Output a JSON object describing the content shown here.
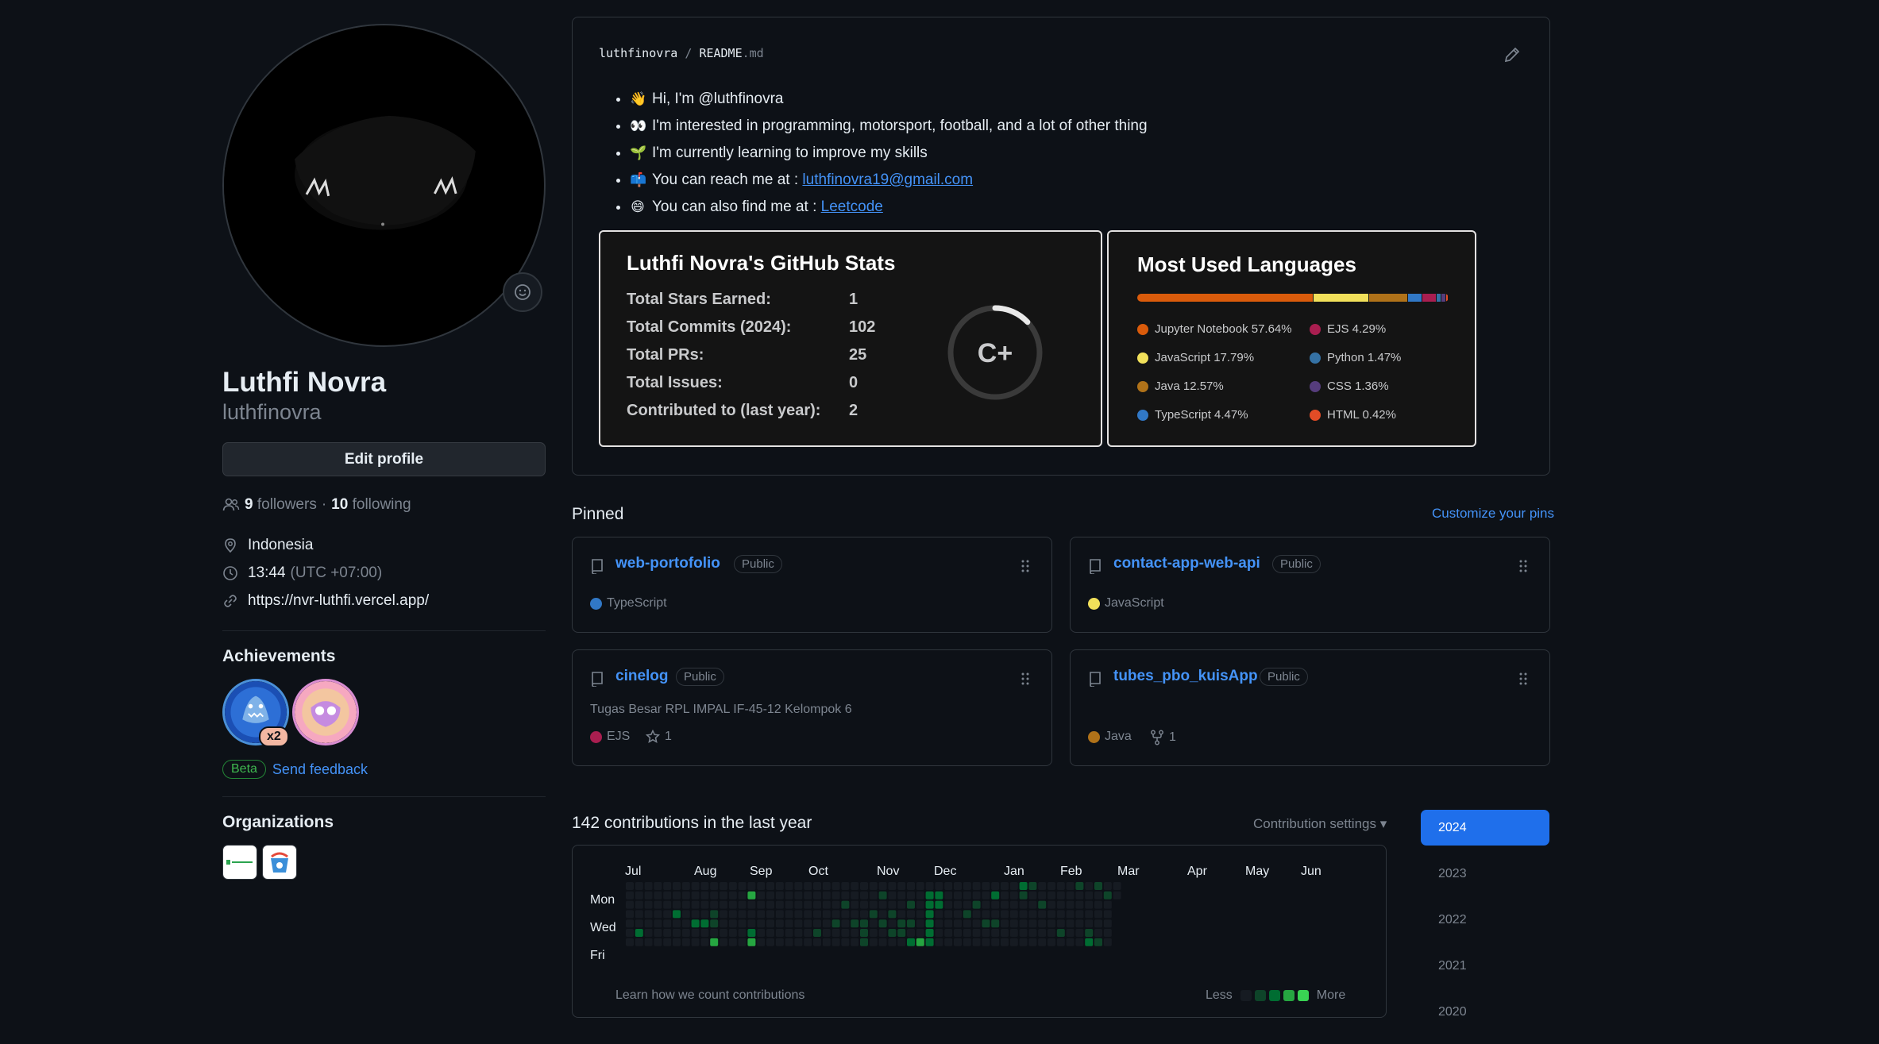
{
  "profile": {
    "full_name": "Luthfi Novra",
    "login": "luthfinovra",
    "edit_label": "Edit profile",
    "followers_count": "9",
    "followers_label": "followers",
    "sep": "·",
    "following_count": "10",
    "following_label": "following",
    "location": "Indonesia",
    "time": "13:44",
    "timezone": "(UTC +07:00)",
    "website": "https://nvr-luthfi.vercel.app/"
  },
  "achievements": {
    "title": "Achievements",
    "multiplier": "x2",
    "beta_label": "Beta",
    "feedback_label": "Send feedback"
  },
  "organizations": {
    "title": "Organizations"
  },
  "readme": {
    "owner": "luthfinovra",
    "slash": "/",
    "file": "README",
    "ext": ".md",
    "lines": [
      {
        "emoji": "👋",
        "text": "Hi, I'm @luthfinovra",
        "link": ""
      },
      {
        "emoji": "👀",
        "text": "I'm interested in programming, motorsport, football, and a lot of other thing",
        "link": ""
      },
      {
        "emoji": "🌱",
        "text": "I'm currently learning to improve my skills",
        "link": ""
      },
      {
        "emoji": "📫",
        "text": "You can reach me at : ",
        "link": "luthfinovra19@gmail.com"
      },
      {
        "emoji": "😄",
        "text": "You can also find me at : ",
        "link": "Leetcode"
      }
    ]
  },
  "stats_card": {
    "title": "Luthfi Novra's GitHub Stats",
    "rows": [
      {
        "label": "Total Stars Earned:",
        "value": "1"
      },
      {
        "label": "Total Commits (2024):",
        "value": "102"
      },
      {
        "label": "Total PRs:",
        "value": "25"
      },
      {
        "label": "Total Issues:",
        "value": "0"
      },
      {
        "label": "Contributed to (last year):",
        "value": "2"
      }
    ],
    "rank": "C+",
    "rank_progress": 0.13
  },
  "languages_card": {
    "title": "Most Used Languages",
    "items": [
      {
        "name": "Jupyter Notebook 57.64%",
        "pct": 57.64,
        "color": "#DA5B0B"
      },
      {
        "name": "JavaScript 17.79%",
        "pct": 17.79,
        "color": "#f1e05a"
      },
      {
        "name": "Java 12.57%",
        "pct": 12.57,
        "color": "#b07219"
      },
      {
        "name": "TypeScript 4.47%",
        "pct": 4.47,
        "color": "#3178c6"
      },
      {
        "name": "EJS 4.29%",
        "pct": 4.29,
        "color": "#a91e50"
      },
      {
        "name": "Python 1.47%",
        "pct": 1.47,
        "color": "#3572A5"
      },
      {
        "name": "CSS 1.36%",
        "pct": 1.36,
        "color": "#563d7c"
      },
      {
        "name": "HTML 0.42%",
        "pct": 0.42,
        "color": "#e34c26"
      }
    ]
  },
  "pinned": {
    "title": "Pinned",
    "customize_label": "Customize your pins",
    "repos": [
      {
        "name": "web-portofolio",
        "visibility": "Public",
        "desc": "",
        "lang": "TypeScript",
        "lang_color": "#3178c6",
        "stars": "",
        "forks": ""
      },
      {
        "name": "contact-app-web-api",
        "visibility": "Public",
        "desc": "",
        "lang": "JavaScript",
        "lang_color": "#f1e05a",
        "stars": "",
        "forks": ""
      },
      {
        "name": "cinelog",
        "visibility": "Public",
        "desc": "Tugas Besar RPL IMPAL IF-45-12 Kelompok 6",
        "lang": "EJS",
        "lang_color": "#a91e50",
        "stars": "1",
        "forks": ""
      },
      {
        "name": "tubes_pbo_kuisApp",
        "visibility": "Public",
        "desc": "",
        "lang": "Java",
        "lang_color": "#b07219",
        "stars": "",
        "forks": "1"
      }
    ]
  },
  "contributions": {
    "title": "142 contributions in the last year",
    "settings_label": "Contribution settings ▾",
    "months": [
      "Jul",
      "Aug",
      "Sep",
      "Oct",
      "Nov",
      "Dec",
      "Jan",
      "Feb",
      "Mar",
      "Apr",
      "May",
      "Jun"
    ],
    "days": [
      "Mon",
      "Wed",
      "Fri"
    ],
    "learn_label": "Learn how we count contributions",
    "less_label": "Less",
    "more_label": "More",
    "active_cells": [
      [
        1,
        5,
        2
      ],
      [
        5,
        3,
        2
      ],
      [
        7,
        4,
        2
      ],
      [
        8,
        4,
        2
      ],
      [
        9,
        3,
        1
      ],
      [
        9,
        4,
        1
      ],
      [
        13,
        1,
        3
      ],
      [
        9,
        6,
        3
      ],
      [
        13,
        5,
        2
      ],
      [
        13,
        6,
        3
      ],
      [
        20,
        5,
        1
      ],
      [
        23,
        2,
        1
      ],
      [
        22,
        4,
        1
      ],
      [
        25,
        5,
        1
      ],
      [
        25,
        6,
        1
      ],
      [
        26,
        3,
        1
      ],
      [
        24,
        4,
        1
      ],
      [
        25,
        4,
        1
      ],
      [
        27,
        1,
        1
      ],
      [
        28,
        3,
        1
      ],
      [
        28,
        5,
        1
      ],
      [
        27,
        4,
        1
      ],
      [
        29,
        4,
        1
      ],
      [
        29,
        5,
        1
      ],
      [
        30,
        2,
        1
      ],
      [
        30,
        4,
        1
      ],
      [
        30,
        6,
        2
      ],
      [
        31,
        6,
        3
      ],
      [
        32,
        1,
        2
      ],
      [
        32,
        2,
        2
      ],
      [
        32,
        3,
        2
      ],
      [
        32,
        4,
        2
      ],
      [
        32,
        5,
        2
      ],
      [
        32,
        6,
        2
      ],
      [
        33,
        1,
        2
      ],
      [
        33,
        2,
        2
      ],
      [
        36,
        3,
        1
      ],
      [
        37,
        2,
        1
      ],
      [
        38,
        4,
        1
      ],
      [
        39,
        1,
        2
      ],
      [
        39,
        4,
        1
      ],
      [
        42,
        0,
        2
      ],
      [
        42,
        1,
        1
      ],
      [
        43,
        0,
        1
      ],
      [
        44,
        2,
        1
      ],
      [
        46,
        5,
        1
      ],
      [
        48,
        0,
        1
      ],
      [
        49,
        6,
        1
      ],
      [
        49,
        5,
        1
      ],
      [
        50,
        0,
        1
      ],
      [
        49,
        6,
        2
      ],
      [
        50,
        6,
        1
      ],
      [
        51,
        1,
        1
      ],
      [
        52,
        2,
        2
      ],
      [
        52,
        5,
        1
      ],
      [
        53,
        6,
        1
      ],
      [
        54,
        4,
        1
      ],
      [
        54,
        6,
        2
      ],
      [
        55,
        4,
        1
      ],
      [
        55,
        5,
        1
      ],
      [
        56,
        6,
        1
      ],
      [
        57,
        1,
        2
      ],
      [
        57,
        2,
        1
      ],
      [
        57,
        3,
        1
      ],
      [
        57,
        5,
        2
      ],
      [
        58,
        5,
        1
      ],
      [
        60,
        5,
        1
      ],
      [
        61,
        2,
        1
      ],
      [
        61,
        6,
        1
      ],
      [
        62,
        5,
        2
      ]
    ]
  },
  "years": [
    "2024",
    "2023",
    "2022",
    "2021",
    "2020"
  ]
}
